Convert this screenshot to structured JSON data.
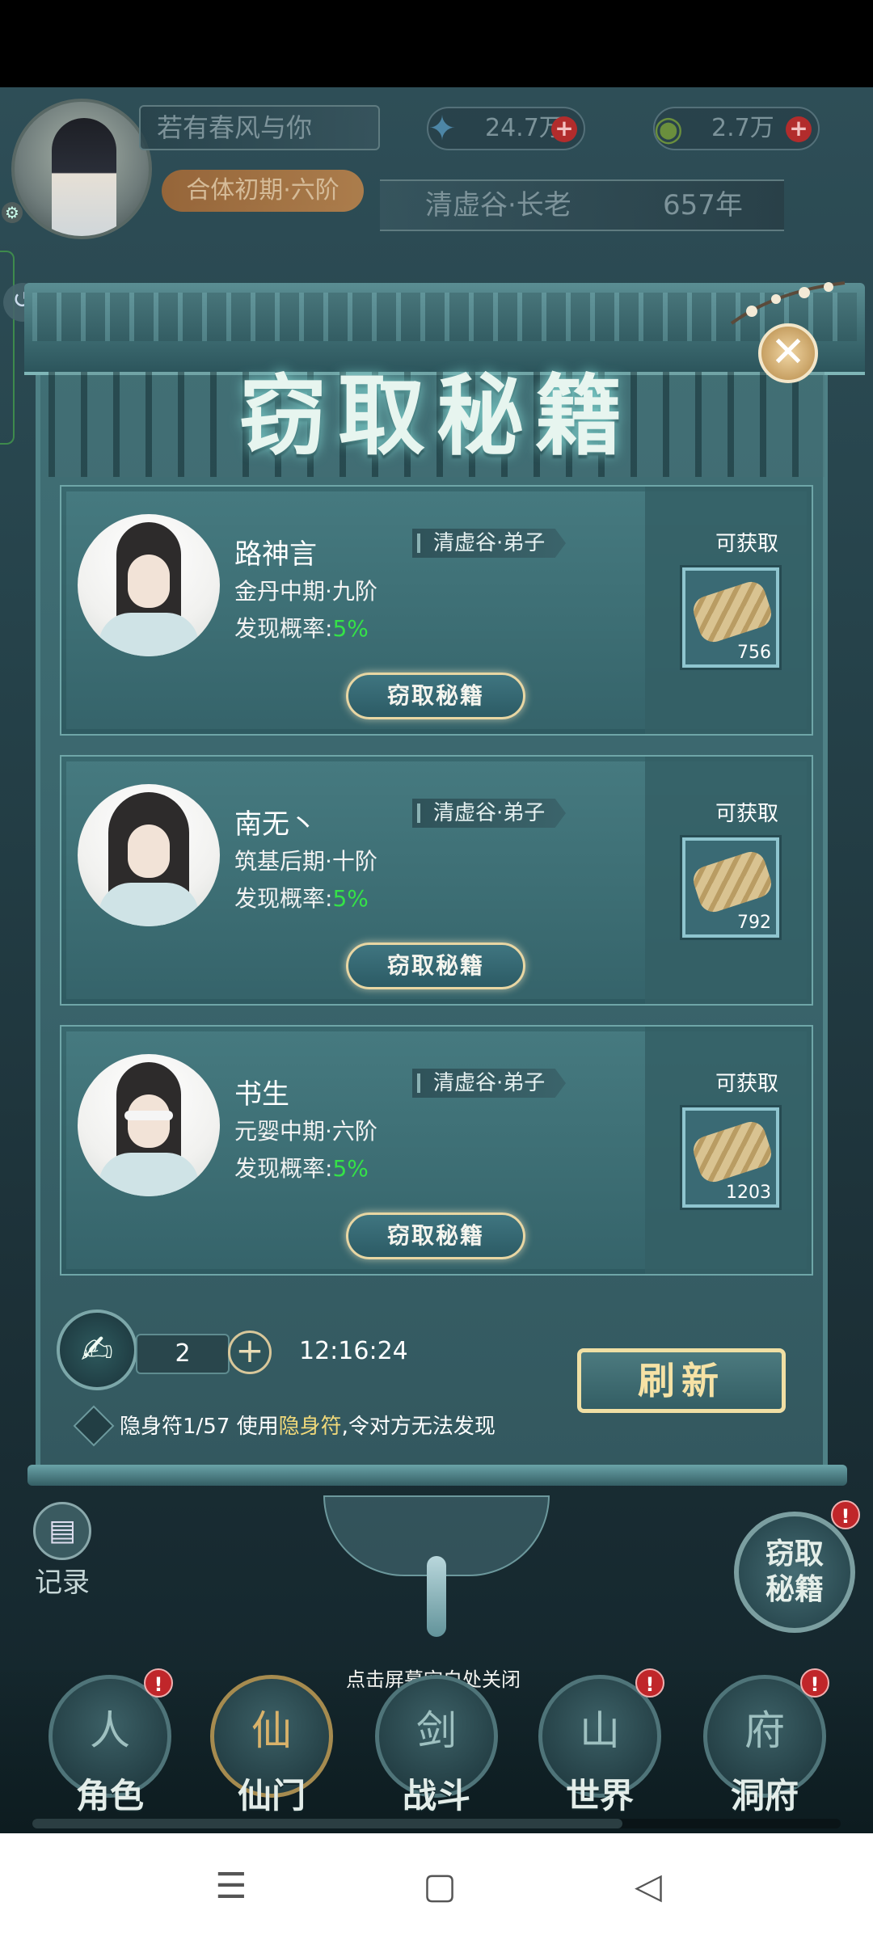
{
  "header": {
    "player_name": "若有春风与你",
    "realm": "合体初期·六阶",
    "resource_1": "24.7万",
    "resource_2": "2.7万",
    "sect_title": "清虚谷·长老",
    "age": "657年"
  },
  "modal": {
    "title": "窃取秘籍",
    "obtain_label": "可获取",
    "steal_button": "窃取秘籍",
    "targets": [
      {
        "name": "路神言",
        "tag": "清虚谷·弟子",
        "rank": "金丹中期·九阶",
        "prob_label": "发现概率:",
        "prob_value": "5%",
        "item_count": "756"
      },
      {
        "name": "南无丶",
        "tag": "清虚谷·弟子",
        "rank": "筑基后期·十阶",
        "prob_label": "发现概率:",
        "prob_value": "5%",
        "item_count": "792"
      },
      {
        "name": "书生",
        "tag": "清虚谷·弟子",
        "rank": "元婴中期·六阶",
        "prob_label": "发现概率:",
        "prob_value": "5%",
        "item_count": "1203"
      }
    ],
    "count_value": "2",
    "timer": "12:16:24",
    "refresh_label": "刷新",
    "hint_prefix": "隐身符1/57 使用",
    "hint_highlight": "隐身符",
    "hint_suffix": ",令对方无法发现"
  },
  "bottom": {
    "record_label": "记录",
    "steal_round_line1": "窃取",
    "steal_round_line2": "秘籍",
    "close_tip": "点击屏幕空白处关闭",
    "badge": "!",
    "nav": [
      {
        "label": "角色",
        "glyph": "人"
      },
      {
        "label": "仙门",
        "glyph": "仙"
      },
      {
        "label": "战斗",
        "glyph": "剑"
      },
      {
        "label": "世界",
        "glyph": "山"
      },
      {
        "label": "洞府",
        "glyph": "府"
      }
    ]
  },
  "system_nav": {
    "menu": "☰",
    "home": "▢",
    "back": "◁"
  },
  "colors": {
    "highlight_green": "#35e247",
    "highlight_gold": "#f1d97a",
    "badge_red": "#c0262a"
  },
  "icons": [
    "gear-icon",
    "feather-icon",
    "coin-icon",
    "plus-icon",
    "close-icon",
    "scroll-icon",
    "talisman-icon",
    "clipboard-icon"
  ]
}
